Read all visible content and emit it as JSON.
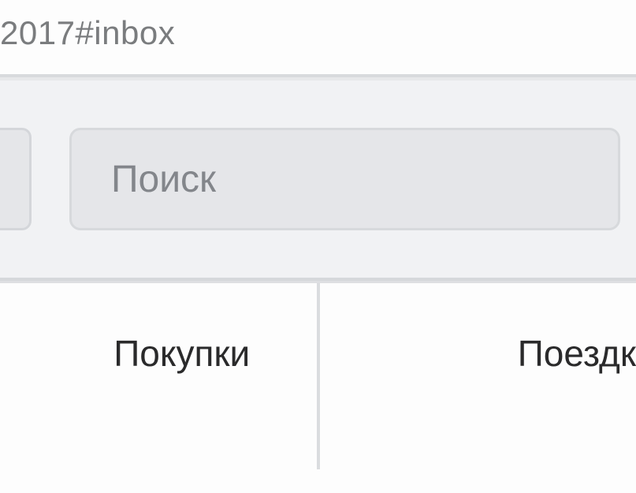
{
  "address_bar": {
    "url_fragment": "2017#inbox"
  },
  "toolbar": {
    "search": {
      "placeholder": "Поиск"
    }
  },
  "tabs": {
    "tab1": {
      "label": "Покупки"
    },
    "tab2": {
      "label": "Поездк"
    }
  }
}
